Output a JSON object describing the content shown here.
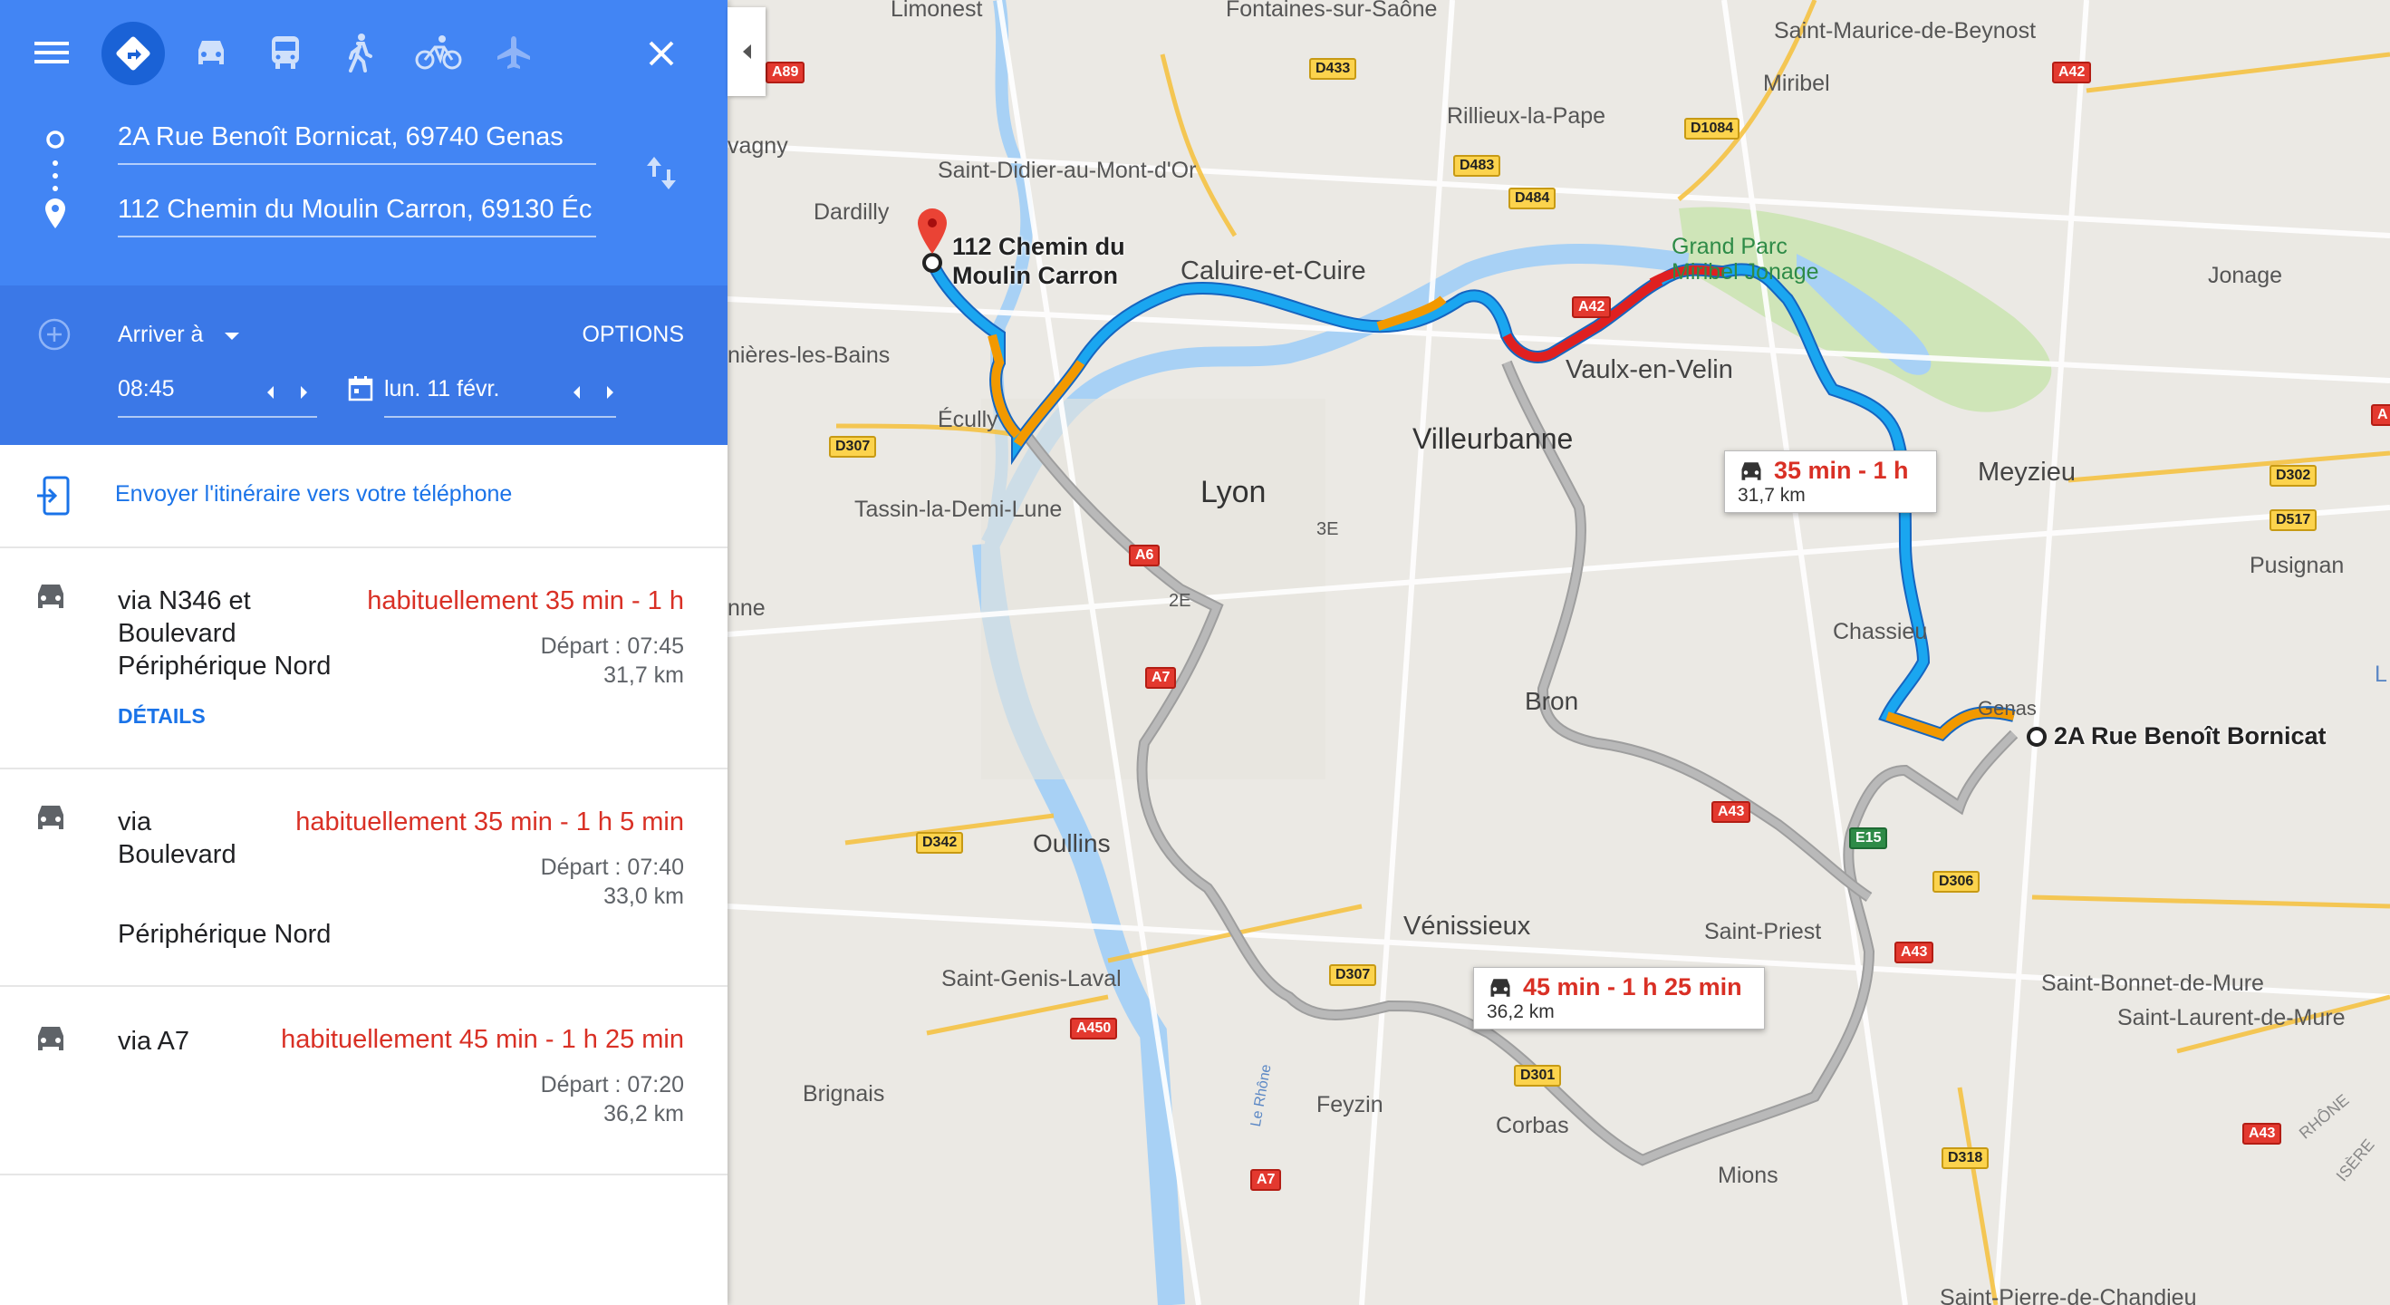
{
  "header": {
    "origin": "2A Rue Benoît Bornicat, 69740 Genas",
    "destination": "112 Chemin du Moulin Carron, 69130 Éc",
    "arrive_label": "Arriver à",
    "options_label": "OPTIONS",
    "time": "08:45",
    "date": "lun. 11 févr."
  },
  "send_to_phone": "Envoyer l'itinéraire vers votre téléphone",
  "routes": [
    {
      "via": "via N346 et Boulevard Périphérique Nord",
      "via_lines": [
        "via N346 et",
        "Boulevard",
        "Périphérique Nord"
      ],
      "time": "habituellement 35 min - 1 h",
      "departure": "Départ : 07:45",
      "distance": "31,7 km",
      "details": "DÉTAILS"
    },
    {
      "via": "via Boulevard Périphérique Nord",
      "via_lines": [
        "via",
        "Boulevard",
        "Périphérique Nord"
      ],
      "time": "habituellement 35 min - 1 h 5 min",
      "departure": "Départ : 07:40",
      "distance": "33,0 km"
    },
    {
      "via": "via A7",
      "via_lines": [
        "via A7"
      ],
      "time": "habituellement 45 min - 1 h 25 min",
      "departure": "Départ : 07:20",
      "distance": "36,2 km"
    }
  ],
  "map": {
    "callouts": [
      {
        "time": "35 min - 1 h",
        "distance": "31,7 km"
      },
      {
        "time": "45 min - 1 h 25 min",
        "distance": "36,2 km"
      }
    ],
    "destination_pin_label": "112 Chemin du Moulin Carron",
    "destination_pin_lines": [
      "112 Chemin du",
      "Moulin Carron"
    ],
    "origin_pin_label": "2A Rue Benoît Bornicat",
    "places": {
      "limonest": "Limonest",
      "fontaines": "Fontaines-sur-Saône",
      "saint_maurice": "Saint-Maurice-de-Beynost",
      "miribel": "Miribel",
      "rillieux": "Rillieux-la-Pape",
      "vagny": "vagny",
      "saint_didier": "Saint-Didier-au-Mont-d'Or",
      "dardilly": "Dardilly",
      "caluire": "Caluire-et-Cuire",
      "grand_parc": "Grand Parc\nMiribel Jonage",
      "jonage": "Jonage",
      "nieres": "nières-les-Bains",
      "vaulx": "Vaulx-en-Velin",
      "ecully": "Écully",
      "villeurbanne": "Villeurbanne",
      "meyzieu": "Meyzieu",
      "tassin": "Tassin-la-Demi-Lune",
      "lyon": "Lyon",
      "3e": "3E",
      "2e": "2E",
      "nne": "nne",
      "pusignan": "Pusignan",
      "chassieu": "Chassieu",
      "bron": "Bron",
      "genas": "Genas",
      "oullins": "Oullins",
      "saint_priest": "Saint-Priest",
      "venissieux": "Vénissieux",
      "saint_genis": "Saint-Genis-Laval",
      "saint_bonnet": "Saint-Bonnet-de-Mure",
      "saint_laurent": "Saint-Laurent-de-Mure",
      "brignais": "Brignais",
      "feyzin": "Feyzin",
      "corbas": "Corbas",
      "mions": "Mions",
      "le_rhone": "Le Rhône",
      "rhone": "RHÔNE",
      "isere": "ISÈRE",
      "saint_pierre": "Saint-Pierre-de-Chandieu",
      "l": "L"
    },
    "shields": [
      "A89",
      "D433",
      "A42",
      "D1084",
      "D483",
      "D484",
      "A42",
      "D307",
      "A6",
      "A7",
      "D302",
      "D517",
      "A43",
      "E15",
      "D306",
      "D342",
      "D307",
      "A43",
      "A450",
      "D301",
      "D318",
      "A7",
      "A43",
      "A"
    ]
  },
  "colors": {
    "header_blue": "#4285f4",
    "header_dark": "#3b78e7",
    "route_blue": "#1aa6f0",
    "traffic_orange": "#f29900",
    "traffic_red": "#e02020",
    "time_red": "#d93025"
  }
}
